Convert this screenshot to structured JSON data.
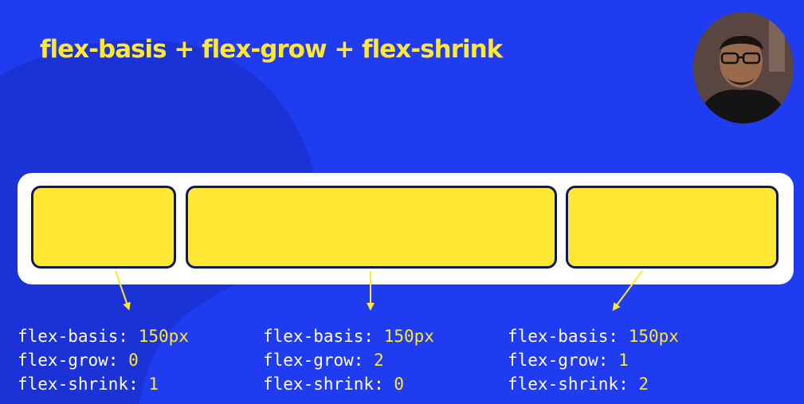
{
  "slide": {
    "title": "flex-basis + flex-grow + flex-shrink",
    "colors": {
      "background": "#1f3cf0",
      "accent": "#ffe733",
      "container": "#ffffff",
      "border": "#0f1a5c"
    }
  },
  "presenter": {
    "icon": "presenter-webcam-avatar"
  },
  "items": [
    {
      "basis_label": "flex-basis: ",
      "basis": "150px",
      "grow_label": "flex-grow: ",
      "grow": "0",
      "shrink_label": "flex-shrink: ",
      "shrink": "1"
    },
    {
      "basis_label": "flex-basis: ",
      "basis": "150px",
      "grow_label": "flex-grow: ",
      "grow": "2",
      "shrink_label": "flex-shrink: ",
      "shrink": "0"
    },
    {
      "basis_label": "flex-basis: ",
      "basis": "150px",
      "grow_label": "flex-grow: ",
      "grow": "1",
      "shrink_label": "flex-shrink: ",
      "shrink": "2"
    }
  ]
}
